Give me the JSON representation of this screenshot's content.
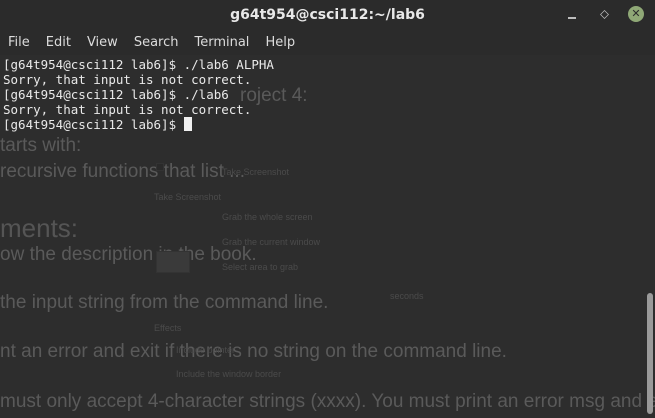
{
  "window": {
    "title": "g64t954@csci112:~/lab6"
  },
  "menu": [
    "File",
    "Edit",
    "View",
    "Search",
    "Terminal",
    "Help"
  ],
  "terminal": {
    "lines": [
      "[g64t954@csci112 lab6]$ ./lab6 ALPHA",
      "Sorry, that input is not correct.",
      "[g64t954@csci112 lab6]$ ./lab6",
      "Sorry, that input is not correct.",
      "[g64t954@csci112 lab6]$ "
    ]
  },
  "background_text": {
    "t1": "roject 4:",
    "t2": "tarts with:",
    "t3": "recursive functions that list ...",
    "t4": "ments:",
    "t5": "ow the description in the book.",
    "t6": "the input string from the command line.",
    "t7": "nt an error and exit if there is no string on the command line.",
    "t8": "must only accept 4-character strings (xxxx).  You must print an error msg and e",
    "s1": "Take Screenshot",
    "s2": "Take Screenshot",
    "s3": "Grab the whole screen",
    "s4": "Grab the current window",
    "s5": "Select area to grab",
    "s6": "Effects",
    "s7": "Include pointer",
    "s8": "Include the window border",
    "s9": "seconds"
  },
  "colors": {
    "accent_close": "#8fa876",
    "terminal_bg": "#2d2d2d",
    "text": "#e9e9e9"
  }
}
